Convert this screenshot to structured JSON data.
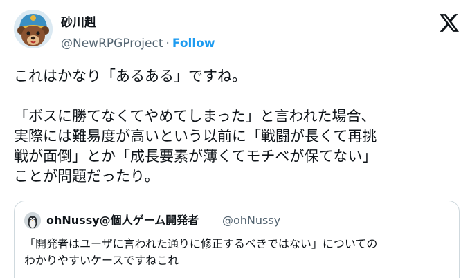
{
  "author": {
    "display_name": "砂川赳",
    "handle": "@NewRPGProject",
    "separator": "·",
    "follow_label": "Follow"
  },
  "tweet": {
    "text": "これはかなり「あるある」ですね。\n\n「ボスに勝てなくてやめてしまった」と言われた場合、\n実際には難易度が高いという以前に「戦闘が長くて再挑\n戦が面倒」とか「成長要素が薄くてモチベが保てない」\nことが問題だったり。"
  },
  "quote": {
    "display_name": "ohNussy@個人ゲーム開発者",
    "handle": "@ohNussy",
    "text": "「開発者はユーザに言われた通りに修正するべきではない」についての\nわかりやすいケースですねこれ"
  },
  "icons": {
    "avatar": "bear-avatar",
    "quote_avatar": "penguin-avatar",
    "logo": "x-logo-icon"
  },
  "colors": {
    "follow": "#1d9bf0",
    "secondary_text": "#536471",
    "primary_text": "#0f1419",
    "border": "#cfd9de"
  }
}
